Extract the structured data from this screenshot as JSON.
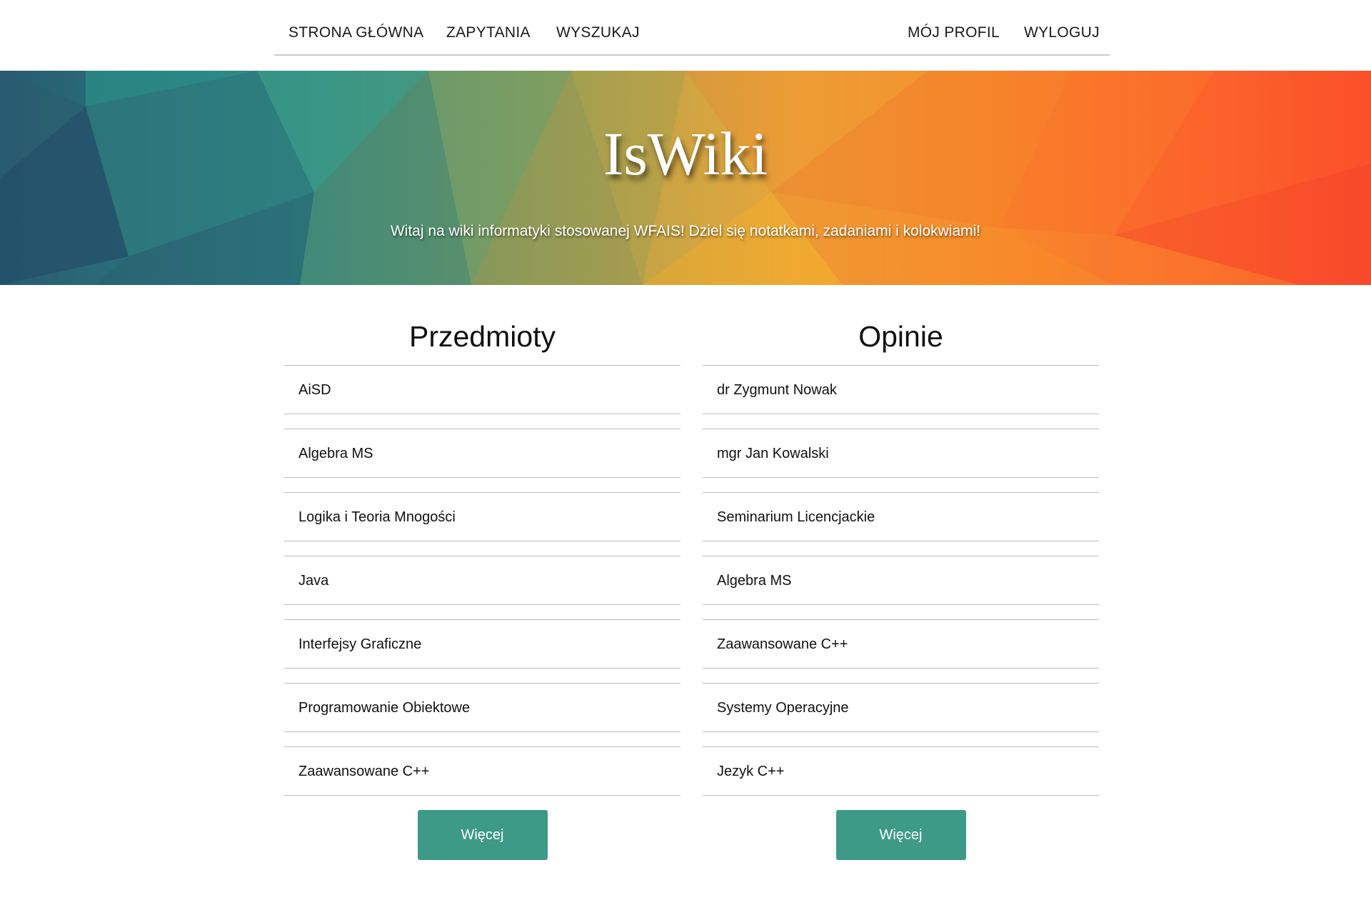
{
  "nav": {
    "left": [
      {
        "label": "STRONA GŁÓWNA"
      },
      {
        "label": "ZAPYTANIA"
      },
      {
        "label": "WYSZUKAJ"
      }
    ],
    "right": [
      {
        "label": "MÓJ PROFIL"
      },
      {
        "label": "WYLOGUJ"
      }
    ]
  },
  "hero": {
    "title": "IsWiki",
    "subtitle": "Witaj na wiki informatyki stosowanej WFAIS! Dziel się notatkami, zadaniami i kolokwiami!"
  },
  "subjects": {
    "title": "Przedmioty",
    "items": [
      "AiSD",
      "Algebra MS",
      "Logika i Teoria Mnogości",
      "Java",
      "Interfejsy Graficzne",
      "Programowanie Obiektowe",
      "Zaawansowane C++"
    ],
    "more_label": "Więcej"
  },
  "opinions": {
    "title": "Opinie",
    "items": [
      "dr Zygmunt Nowak",
      "mgr Jan Kowalski",
      "Seminarium Licencjackie",
      "Algebra MS",
      "Zaawansowane C++",
      "Systemy Operacyjne",
      "Jezyk C++"
    ],
    "more_label": "Więcej"
  },
  "colors": {
    "accent": "#3d9a86",
    "divider": "#bdbdbd"
  }
}
